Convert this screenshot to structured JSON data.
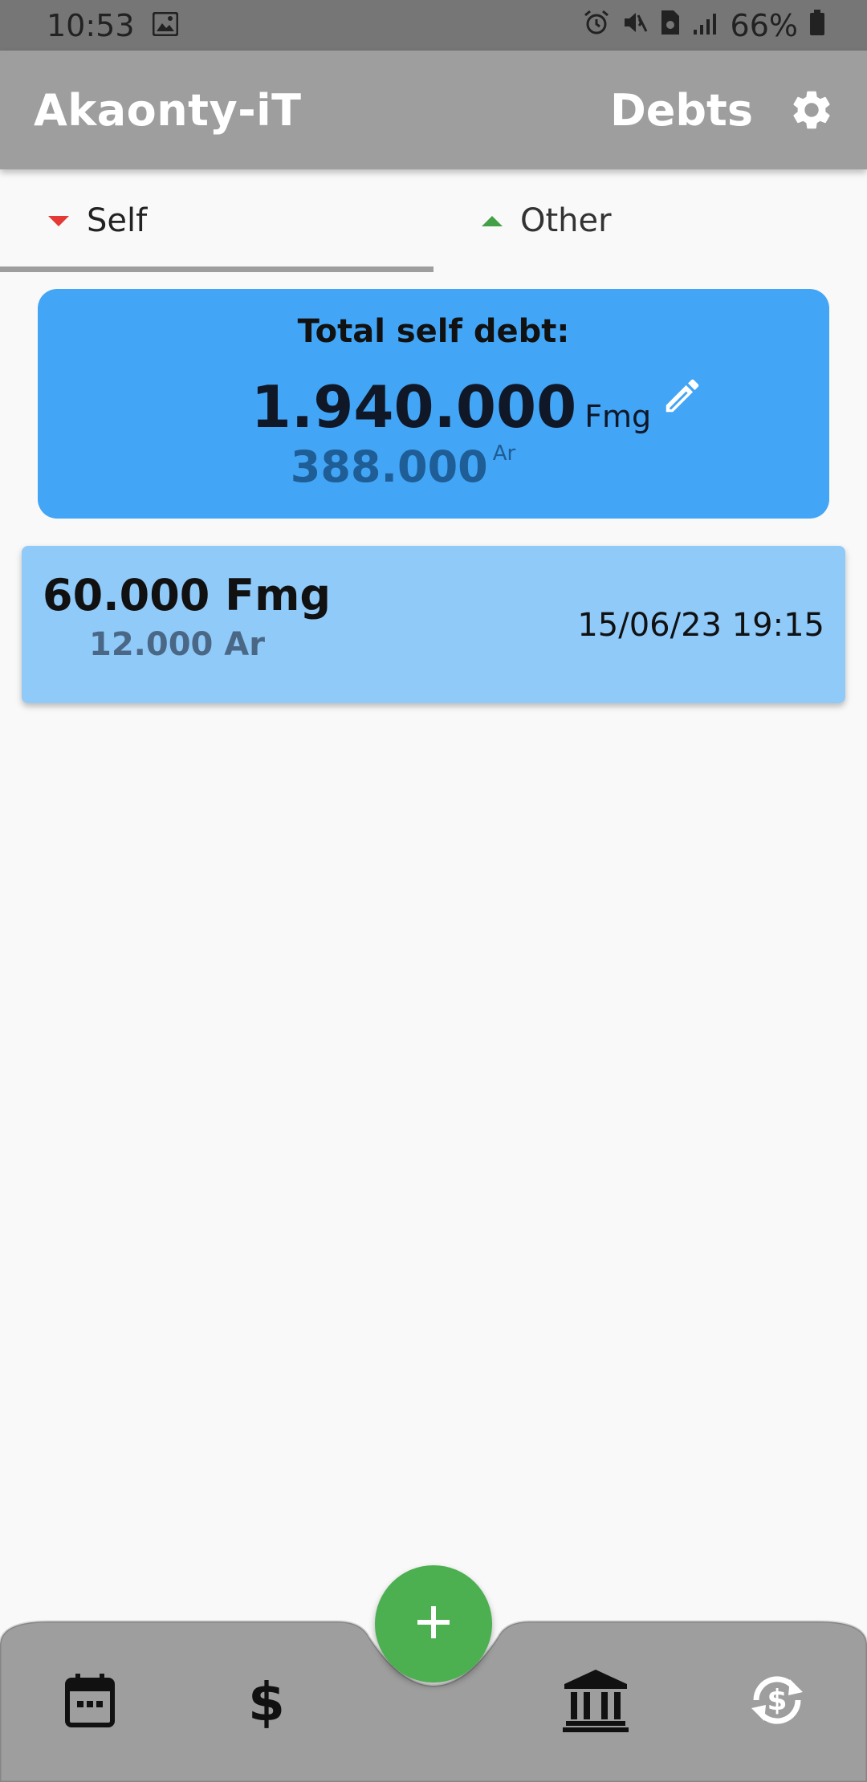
{
  "status_bar": {
    "time": "10:53",
    "battery": "66%",
    "icons": [
      "image-icon",
      "alarm-icon",
      "mute-icon",
      "sim-icon",
      "signal-icon",
      "battery-icon"
    ]
  },
  "app_bar": {
    "title": "Akaonty-iT",
    "page_label": "Debts",
    "settings_icon": "gear-icon"
  },
  "tabs": [
    {
      "label": "Self",
      "selected": true,
      "indicator": "red-down-triangle"
    },
    {
      "label": "Other",
      "selected": false,
      "indicator": "green-up-triangle"
    }
  ],
  "summary": {
    "title": "Total self debt:",
    "main_value": "1.940.000",
    "main_unit": "Fmg",
    "sub_value": "388.000",
    "sub_unit": "Ar",
    "edit_icon": "pencil-icon"
  },
  "debts": [
    {
      "amount": "60.000 Fmg",
      "amount_sub": "12.000 Ar",
      "date": "15/06/23 19:15"
    }
  ],
  "bottom_nav": {
    "items": [
      "calendar-icon",
      "dollar-icon",
      "bank-icon",
      "currency-exchange-icon"
    ],
    "fab_icon": "plus-icon"
  },
  "colors": {
    "status_bar": "#767676",
    "app_bar": "#9e9e9e",
    "summary_card": "#42a5f5",
    "debt_item": "#90caf9",
    "fab": "#4caf50",
    "self_indicator": "#e53935",
    "other_indicator": "#43a047"
  }
}
